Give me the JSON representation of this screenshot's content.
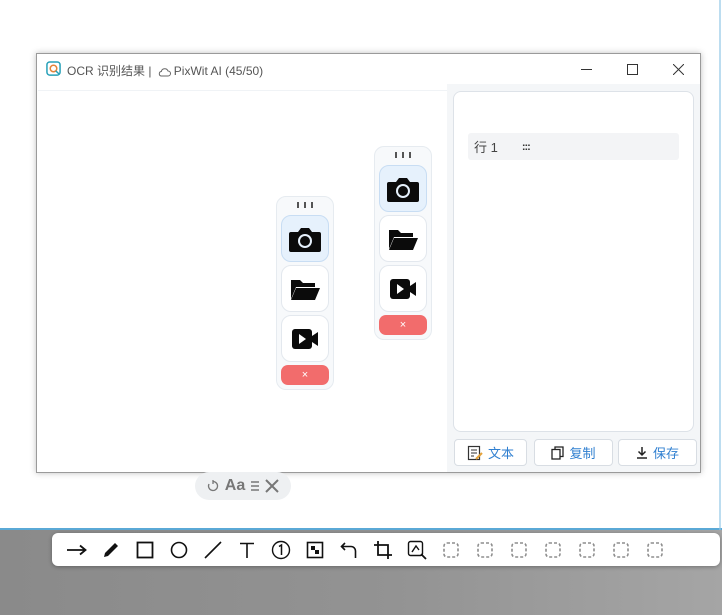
{
  "window": {
    "title": "OCR 识别结果 | ",
    "cloud_label": "PixWit AI (45/50)",
    "minimize_glyph": "—",
    "maximize_glyph": "☐",
    "close_glyph": "✕"
  },
  "floating_panels": [
    {
      "grip": "⁝⁝⁝",
      "buttons": [
        "camera-icon",
        "folder-open-icon",
        "video-icon"
      ],
      "close_label": "×"
    },
    {
      "grip": "⁝⁝⁝",
      "buttons": [
        "camera-icon",
        "folder-open-icon",
        "video-icon"
      ],
      "close_label": "×"
    }
  ],
  "text_toolbar": {
    "label": "Aa",
    "close_glyph": "✕"
  },
  "results": {
    "rows": [
      {
        "label": "行 1",
        "value": ":::"
      }
    ]
  },
  "actions": {
    "text_label": "文本",
    "copy_label": "复制",
    "save_label": "保存"
  },
  "snip_tools": [
    "arrow-tool",
    "pen-tool",
    "rectangle-tool",
    "ellipse-tool",
    "line-tool",
    "text-tool",
    "number-tool",
    "mosaic-tool",
    "undo-tool",
    "crop-tool",
    "ocr-tool",
    "more-tools"
  ],
  "colors": {
    "accent": "#2f7fd0",
    "close_button": "#f26c6c",
    "active_button": "#e6f1fc"
  }
}
